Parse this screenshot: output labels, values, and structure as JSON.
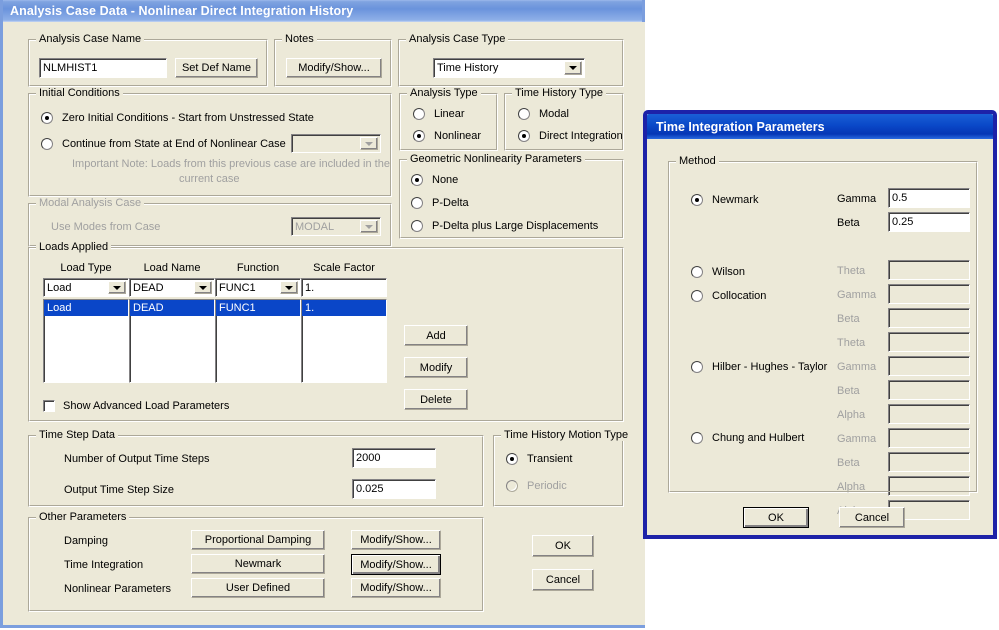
{
  "main_window": {
    "title": "Analysis Case Data - Nonlinear Direct Integration History",
    "analysis_case_name": {
      "group_title": "Analysis Case Name",
      "value": "NLMHIST1",
      "set_def_name_label": "Set Def Name"
    },
    "notes": {
      "group_title": "Notes",
      "modify_show_label": "Modify/Show..."
    },
    "analysis_case_type": {
      "group_title": "Analysis Case Type",
      "selected": "Time History"
    },
    "initial_conditions": {
      "group_title": "Initial Conditions",
      "option_zero": "Zero Initial Conditions - Start from Unstressed State",
      "option_continue": "Continue from State at End of Nonlinear Case",
      "continue_case_value": "",
      "note_line1": "Important Note:   Loads from this previous case are included in the",
      "note_line2": "current case"
    },
    "modal_analysis_case": {
      "group_title": "Modal Analysis Case",
      "label": "Use Modes from Case",
      "value": "MODAL"
    },
    "analysis_type": {
      "group_title": "Analysis Type",
      "option_linear": "Linear",
      "option_nonlinear": "Nonlinear",
      "selected": "Nonlinear"
    },
    "time_history_type": {
      "group_title": "Time History Type",
      "option_modal": "Modal",
      "option_direct": "Direct Integration",
      "selected": "Direct Integration"
    },
    "geometric_nonlinearity": {
      "group_title": "Geometric Nonlinearity Parameters",
      "option_none": "None",
      "option_pdelta": "P-Delta",
      "option_pdelta_large": "P-Delta plus Large Displacements",
      "selected": "None"
    },
    "loads_applied": {
      "group_title": "Loads Applied",
      "columns": [
        "Load Type",
        "Load Name",
        "Function",
        "Scale Factor"
      ],
      "editor_values": [
        "Load",
        "DEAD",
        "FUNC1",
        "1."
      ],
      "rows": [
        [
          "Load",
          "DEAD",
          "FUNC1",
          "1."
        ]
      ],
      "add_label": "Add",
      "modify_label": "Modify",
      "delete_label": "Delete",
      "show_advanced_label": "Show Advanced Load Parameters"
    },
    "time_step_data": {
      "group_title": "Time Step Data",
      "num_steps_label": "Number of Output Time Steps",
      "num_steps_value": "2000",
      "step_size_label": "Output Time Step Size",
      "step_size_value": "0.025"
    },
    "motion_type": {
      "group_title": "Time History Motion Type",
      "option_transient": "Transient",
      "option_periodic": "Periodic",
      "selected": "Transient"
    },
    "other_parameters": {
      "group_title": "Other Parameters",
      "damping_label": "Damping",
      "damping_value": "Proportional Damping",
      "damping_button": "Modify/Show...",
      "time_integration_label": "Time Integration",
      "time_integration_value": "Newmark",
      "time_integration_button": "Modify/Show...",
      "nonlinear_label": "Nonlinear Parameters",
      "nonlinear_value": "User Defined",
      "nonlinear_button": "Modify/Show..."
    },
    "ok_label": "OK",
    "cancel_label": "Cancel"
  },
  "dialog": {
    "title": "Time Integration Parameters",
    "method_group_title": "Method",
    "methods": [
      {
        "name": "Newmark",
        "selected": true
      },
      {
        "name": "Wilson",
        "selected": false
      },
      {
        "name": "Collocation",
        "selected": false
      },
      {
        "name": "Hilber - Hughes - Taylor",
        "selected": false
      },
      {
        "name": "Chung and Hulbert",
        "selected": false
      }
    ],
    "fields": [
      {
        "label": "Gamma",
        "value": "0.5",
        "enabled": true
      },
      {
        "label": "Beta",
        "value": "0.25",
        "enabled": true
      },
      {
        "label": "Theta",
        "value": "",
        "enabled": false
      },
      {
        "label": "Gamma",
        "value": "",
        "enabled": false
      },
      {
        "label": "Beta",
        "value": "",
        "enabled": false
      },
      {
        "label": "Theta",
        "value": "",
        "enabled": false
      },
      {
        "label": "Gamma",
        "value": "",
        "enabled": false
      },
      {
        "label": "Beta",
        "value": "",
        "enabled": false
      },
      {
        "label": "Alpha",
        "value": "",
        "enabled": false
      },
      {
        "label": "Gamma",
        "value": "",
        "enabled": false
      },
      {
        "label": "Beta",
        "value": "",
        "enabled": false
      },
      {
        "label": "Alpha",
        "value": "",
        "enabled": false
      },
      {
        "label": "Alpha-m",
        "value": "",
        "enabled": false
      }
    ],
    "ok_label": "OK",
    "cancel_label": "Cancel"
  },
  "colors": {
    "dialog_face": "#ece9d8",
    "main_titlebar": "#7fa3e0",
    "dialog_titlebar": "#0a48c8",
    "dialog_border": "#1d22a8",
    "selection": "#0a46c8",
    "disabled_text": "#a0a0a0"
  }
}
